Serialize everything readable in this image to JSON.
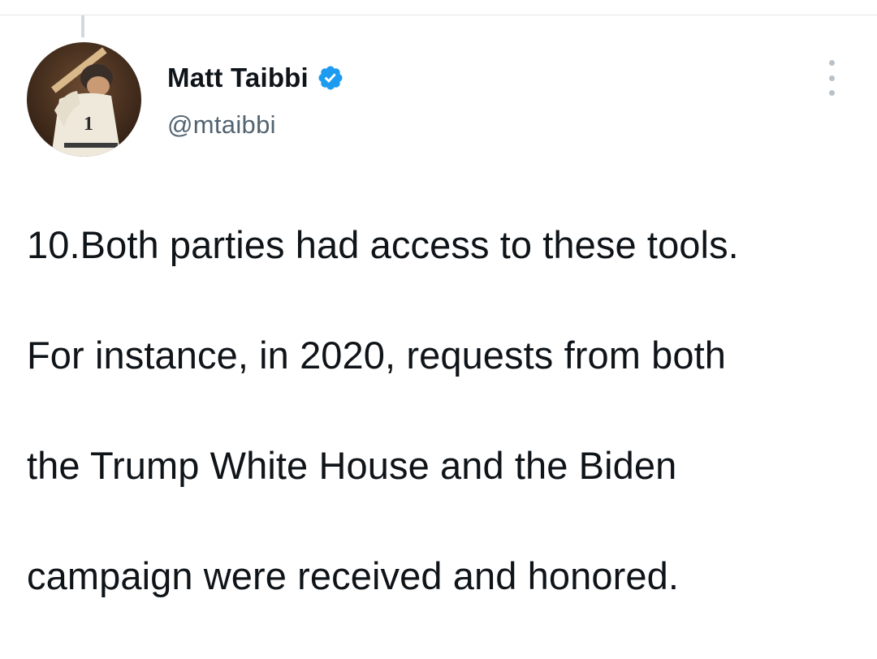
{
  "tweet": {
    "author": {
      "display_name": "Matt Taibbi",
      "handle": "@mtaibbi",
      "verified": true,
      "avatar_icon": "baseball-player-avatar"
    },
    "text_lines": [
      "10.Both parties had access to these tools.",
      "For instance, in 2020, requests from both",
      "the Trump White House and the Biden",
      "campaign were received and honored."
    ],
    "more_options_icon": "vertical-ellipsis-icon"
  },
  "colors": {
    "text": "#0f1419",
    "secondary_text": "#536471",
    "verified_blue": "#1d9bf0",
    "divider": "#e6e6e6"
  }
}
